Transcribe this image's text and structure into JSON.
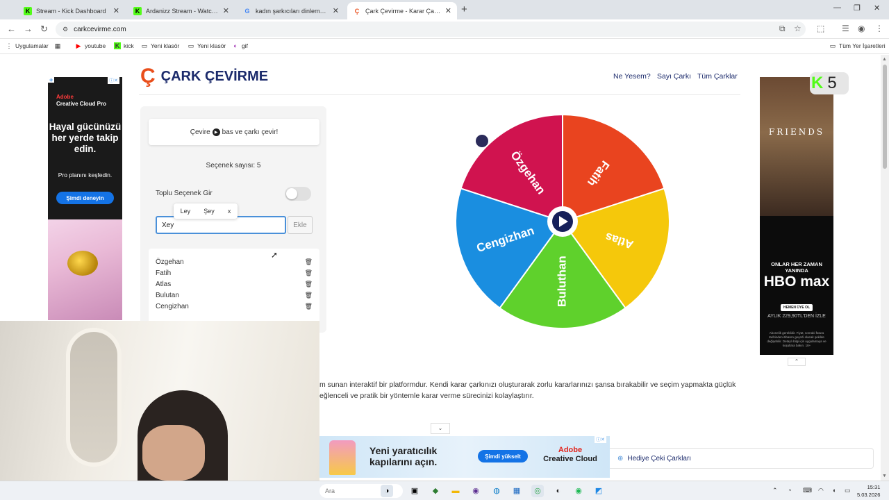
{
  "browser": {
    "tabs": [
      {
        "title": "Stream - Kick Dashboard",
        "icon": "kick-icon"
      },
      {
        "title": "Ardanizz Stream - Watch Live o",
        "icon": "kick-icon"
      },
      {
        "title": "kadın şarkıcıları dinlemek haran",
        "icon": "google-icon"
      },
      {
        "title": "Çark Çevirme - Karar Çarkı!",
        "icon": "cark-icon"
      }
    ],
    "url": "carkcevirme.com",
    "bookmarks": [
      "Uygulamalar",
      "youtube",
      "kick",
      "Yeni klasör",
      "Yeni klasör",
      "gif"
    ],
    "all_bookmarks": "Tüm Yer İşaretleri"
  },
  "site": {
    "title": "ÇARK ÇEVİRME",
    "nav": [
      "Ne Yesem?",
      "Sayı Çarkı",
      "Tüm Çarklar"
    ]
  },
  "controls": {
    "spin_hint_before": "Çevire",
    "spin_hint_after": "bas ve çarkı çevir!",
    "option_count": "Seçenek sayısı: 5",
    "bulk_label": "Toplu Seçenek Gir",
    "suggestions": [
      "Ley",
      "Şey",
      "x"
    ],
    "input_value": "Xey",
    "add_label": "Ekle",
    "options": [
      "Özgehan",
      "Fatih",
      "Atlas",
      "Bulutan",
      "Cengizhan"
    ]
  },
  "wheel": {
    "segments": [
      {
        "label": "Özgehan",
        "color": "#d0134f"
      },
      {
        "label": "Fatih",
        "color": "#e9441f"
      },
      {
        "label": "Atlas",
        "color": "#f5c80b"
      },
      {
        "label": "Buluthan",
        "color": "#5fd12c"
      },
      {
        "label": "Cengizhan",
        "color": "#1a8ee0"
      }
    ]
  },
  "about": {
    "line1": "m sunan interaktif bir platformdur. Kendi karar çarkınızı oluşturarak zorlu kararlarınızı şansa bırakabilir ve seçim yapmakta güçlük",
    "line2": "eğlenceli ve pratik bir yöntemle karar verme sürecinizi kolaylaştırır."
  },
  "ad_left": {
    "brand": "Adobe",
    "product": "Creative Cloud Pro",
    "headline": "Hayal gücünüzü her yerde takip edin.",
    "sub": "Pro planını keşfedin.",
    "cta": "Şimdi deneyin"
  },
  "ad_right": {
    "title": "FRIENDS",
    "tagline": "ONLAR HER ZAMAN YANINDA",
    "brand": "HBO max",
    "member": "HEMEN ÜYE OL",
    "price": "AYLIK 229,90TL'DEN İZLE",
    "fine": "Abonelik gereklidir. Fiyat, sonraki fatura tarihinden itibaren geçerli olacak şekilde değişebilir. Detaylı bilgi için uygulamaya ve koşullara bakın. 18+"
  },
  "kick_badge": {
    "count": "5"
  },
  "ad_bottom": {
    "copy": "Yeni yaratıcılık kapılarını açın.",
    "cta": "Şimdi yükselt",
    "brand": "Adobe",
    "product": "Creative Cloud"
  },
  "hediye_link": "Hediye Çeki Çarkları",
  "taskbar": {
    "search": "Ara",
    "time": "15:31",
    "date": "5.03.2026"
  }
}
